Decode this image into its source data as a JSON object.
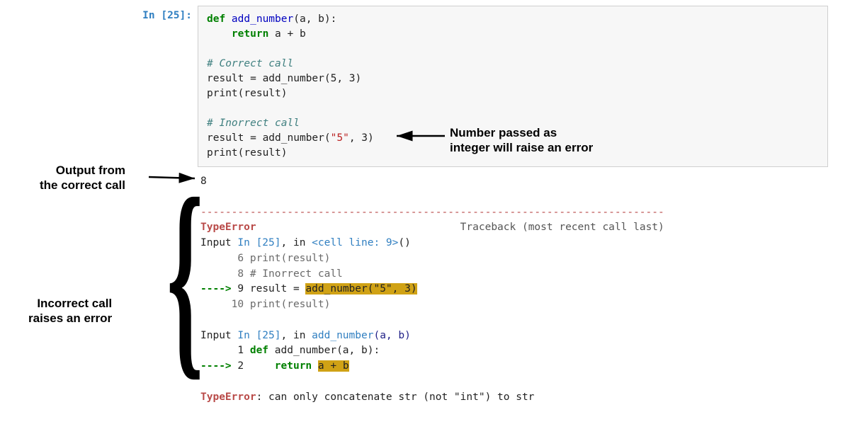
{
  "prompt": {
    "in": "In [",
    "num": "25",
    "close": "]:"
  },
  "code": {
    "l1_def": "def ",
    "l1_fn": "add_number",
    "l1_rest": "(a, b):",
    "l2_ret": "return",
    "l2_expr": " a + b",
    "l4": "# Correct call",
    "l5": "result = add_number(5, 3)",
    "l6": "print(result)",
    "l8": "# Inorrect call",
    "l9a": "result = add_number(",
    "l9_str": "\"5\"",
    "l9b": ", 3)",
    "l10": "print(result)"
  },
  "output": {
    "eight": "8",
    "dashline": "---------------------------------------------------------------------------",
    "err_name": "TypeError",
    "traceback_lbl": "Traceback (most recent call last)",
    "tb1a": "Input ",
    "tb1b": "In [25]",
    "tb1c": ", in ",
    "tb1d": "<cell line: 9>",
    "tb1e": "()",
    "tb_l6": "      6 print(result)",
    "tb_l8": "      8 # Inorrect call",
    "tb_l9_arrow": "----> ",
    "tb_l9_num": "9 ",
    "tb_l9_a": "result = ",
    "tb_l9_hl": "add_number(\"5\", 3)",
    "tb_l10": "     10 print(result)",
    "tb2a": "Input ",
    "tb2b": "In [25]",
    "tb2c": ", in ",
    "tb2d": "add_number",
    "tb2e": "(a, b)",
    "tb_d1_num": "      1 ",
    "tb_d1_def": "def",
    "tb_d1_rest": " add_number(a, b):",
    "tb_d2_arrow": "----> ",
    "tb_d2_num": "2     ",
    "tb_d2_ret": "return",
    "tb_d2_hl": "a + b",
    "final_err": "TypeError",
    "final_msg": ": can only concatenate str (not \"int\") to str"
  },
  "annotations": {
    "a1": "Number passed as\ninteger will raise an error",
    "a2": "Output from\nthe correct call",
    "a3": "Incorrect call\nraises an error"
  }
}
